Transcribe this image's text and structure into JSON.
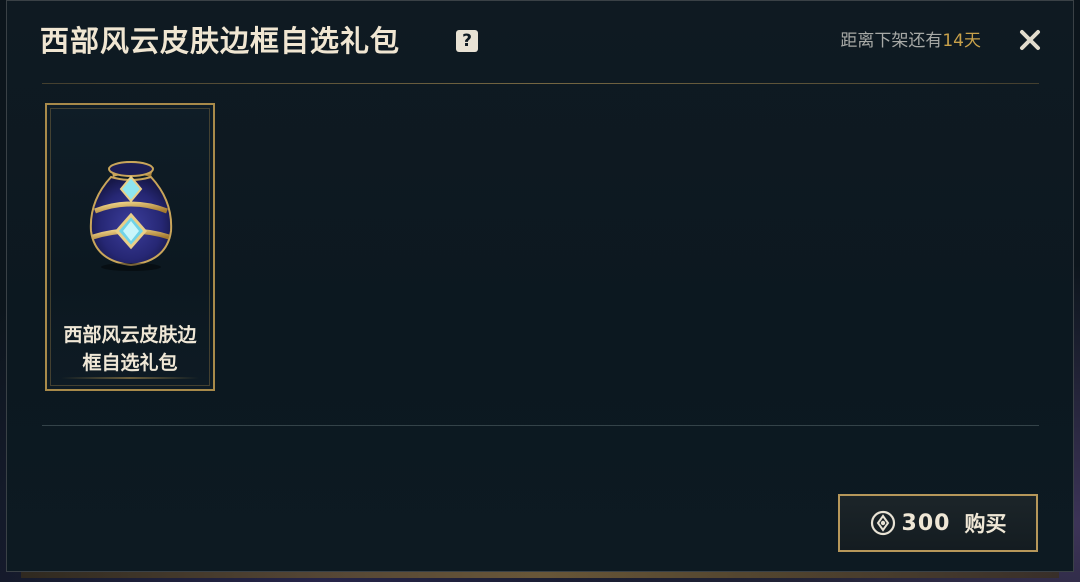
{
  "dialog": {
    "title": "西部风云皮肤边框自选礼包",
    "help_icon_glyph": "?",
    "countdown_prefix": "距离下架还有",
    "countdown_days": "14天",
    "close_icon": "close-icon"
  },
  "item": {
    "name_line1": "西部风云皮肤边",
    "name_line2": "框自选礼包",
    "icon": "loot-bag-icon"
  },
  "purchase": {
    "currency_icon": "rp-currency-icon",
    "price": "300",
    "label": "购买"
  },
  "colors": {
    "accent_gold": "#c8a14a",
    "border_gold": "#a88a4a",
    "text_light": "#efe7d6",
    "background": "#0c1820"
  }
}
